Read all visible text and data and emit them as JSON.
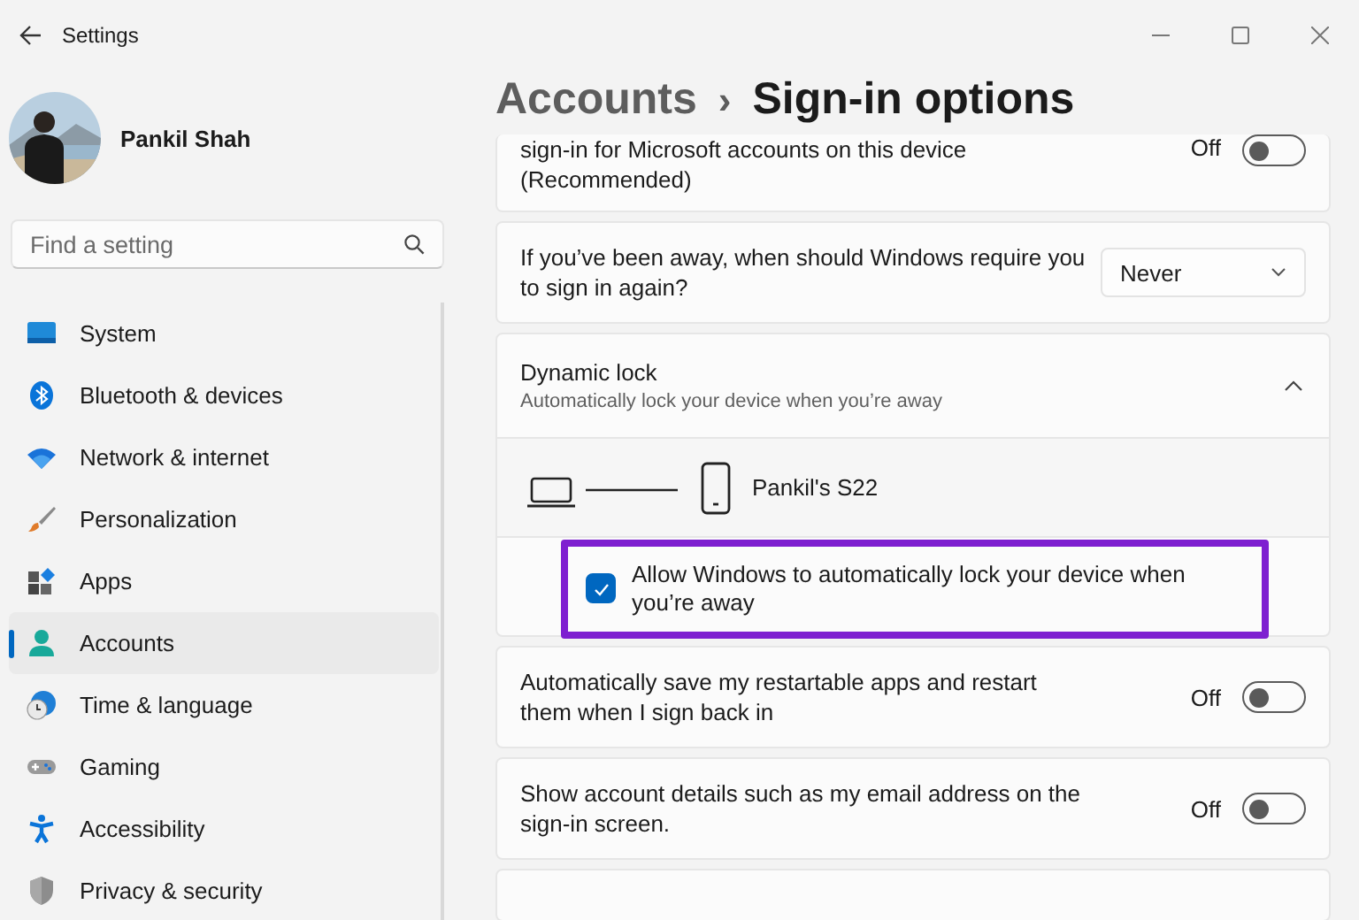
{
  "window": {
    "title": "Settings"
  },
  "user": {
    "name": "Pankil Shah"
  },
  "search": {
    "placeholder": "Find a setting"
  },
  "nav": [
    {
      "label": "System",
      "selected": false
    },
    {
      "label": "Bluetooth & devices",
      "selected": false
    },
    {
      "label": "Network & internet",
      "selected": false
    },
    {
      "label": "Personalization",
      "selected": false
    },
    {
      "label": "Apps",
      "selected": false
    },
    {
      "label": "Accounts",
      "selected": true
    },
    {
      "label": "Time & language",
      "selected": false
    },
    {
      "label": "Gaming",
      "selected": false
    },
    {
      "label": "Accessibility",
      "selected": false
    },
    {
      "label": "Privacy & security",
      "selected": false
    }
  ],
  "breadcrumb": {
    "parent": "Accounts",
    "separator": "›",
    "current": "Sign-in options"
  },
  "settings": [
    {
      "kind": "toggle",
      "text": "sign-in for Microsoft accounts on this device (Recommended)",
      "state_label": "Off",
      "on": false
    },
    {
      "kind": "dropdown",
      "text": "If you’ve been away, when should Windows require you to sign in again?",
      "value": "Never"
    },
    {
      "kind": "expander",
      "title": "Dynamic lock",
      "subtitle": "Automatically lock your device when you’re away",
      "expanded": true,
      "children": [
        {
          "kind": "device",
          "name": "Pankil's S22"
        },
        {
          "kind": "checkbox",
          "text": "Allow Windows to automatically lock your device when you’re away",
          "checked": true,
          "highlighted": true
        }
      ]
    },
    {
      "kind": "toggle",
      "text": "Automatically save my restartable apps and restart them when I sign back in",
      "state_label": "Off",
      "on": false
    },
    {
      "kind": "toggle",
      "text": "Show account details such as my email address on the sign-in screen.",
      "state_label": "Off",
      "on": false
    },
    {
      "kind": "blank"
    }
  ]
}
